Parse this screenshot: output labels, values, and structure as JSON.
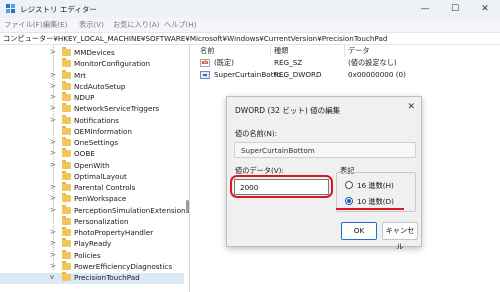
{
  "window": {
    "title": "レジストリ エディター",
    "minimize": "—",
    "maximize": "☐",
    "close": "✕"
  },
  "menu": [
    "ファイル(F)",
    "編集(E)",
    "表示(V)",
    "お気に入り(A)",
    "ヘルプ(H)"
  ],
  "address": "コンピューター¥HKEY_LOCAL_MACHINE¥SOFTWARE¥Microsoft¥Windows¥CurrentVersion¥PrecisionTouchPad",
  "tree": {
    "items": [
      {
        "label": "MMDevices",
        "expander": ">"
      },
      {
        "label": "MonitorConfiguration",
        "expander": ""
      },
      {
        "label": "Mrt",
        "expander": ">"
      },
      {
        "label": "NcdAutoSetup",
        "expander": ">"
      },
      {
        "label": "NDUP",
        "expander": ">"
      },
      {
        "label": "NetworkServiceTriggers",
        "expander": ">"
      },
      {
        "label": "Notifications",
        "expander": ">"
      },
      {
        "label": "OEMInformation",
        "expander": ""
      },
      {
        "label": "OneSettings",
        "expander": ">"
      },
      {
        "label": "OOBE",
        "expander": ">"
      },
      {
        "label": "OpenWith",
        "expander": ">"
      },
      {
        "label": "OptimalLayout",
        "expander": ""
      },
      {
        "label": "Parental Controls",
        "expander": ">"
      },
      {
        "label": "PenWorkspace",
        "expander": ">"
      },
      {
        "label": "PerceptionSimulationExtensions",
        "expander": ">"
      },
      {
        "label": "Personalization",
        "expander": ""
      },
      {
        "label": "PhotoPropertyHandler",
        "expander": ">"
      },
      {
        "label": "PlayReady",
        "expander": ">"
      },
      {
        "label": "Policies",
        "expander": ">"
      },
      {
        "label": "PowerEfficiencyDiagnostics",
        "expander": ">"
      },
      {
        "label": "PrecisionTouchPad",
        "expander": "v"
      }
    ],
    "selected_index": 20
  },
  "list": {
    "headers": {
      "name": "名前",
      "type": "種類",
      "data": "データ"
    },
    "rows": [
      {
        "icon": "string-value-icon",
        "icon_text": "ab",
        "name": "(既定)",
        "type": "REG_SZ",
        "data": "(値の設定なし)"
      },
      {
        "icon": "dword-value-icon",
        "icon_text": "",
        "name": "SuperCurtainBotto...",
        "type": "REG_DWORD",
        "data": "0x00000000 (0)"
      }
    ]
  },
  "dialog": {
    "title": "DWORD (32 ビット) 値の編集",
    "close": "✕",
    "name_label": "値の名前(N):",
    "name_value": "SuperCurtainBottom",
    "data_label": "値のデータ(V):",
    "data_value": "2000",
    "base_label": "表記",
    "hex_label": "16 進数(H)",
    "dec_label": "10 進数(D)",
    "selected_base": "10 進数(D)",
    "ok_label": "OK",
    "cancel_label": "キャンセル"
  },
  "colors": {
    "annotation_red": "#e0161d",
    "accent_blue": "#1e6fd0",
    "folder_yellow": "#f1c75a"
  }
}
